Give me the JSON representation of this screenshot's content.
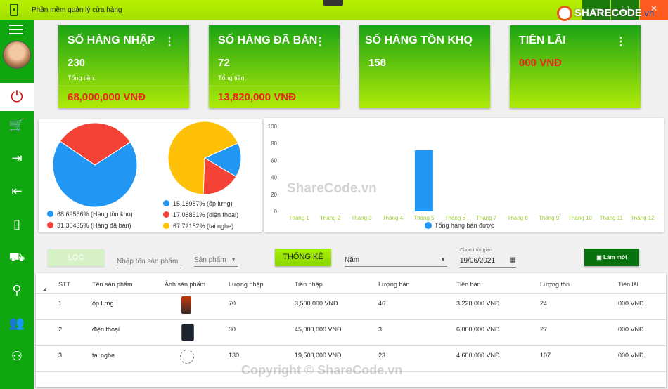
{
  "window": {
    "title": "Phần mềm quản lý cửa hàng",
    "logo_text": "SHARECODE",
    "logo_suffix": ".vn",
    "min_glyph": "—",
    "max_glyph": "▢",
    "close_glyph": "✕"
  },
  "sidebar": {
    "power_glyph": "⏻",
    "items": [
      {
        "name": "cart",
        "glyph": "🛒"
      },
      {
        "name": "export",
        "glyph": "⇥"
      },
      {
        "name": "import",
        "glyph": "⇤"
      },
      {
        "name": "phone",
        "glyph": "▯"
      },
      {
        "name": "truck",
        "glyph": "⛟"
      },
      {
        "name": "search",
        "glyph": "⚲"
      },
      {
        "name": "staff",
        "glyph": "👥"
      },
      {
        "name": "group",
        "glyph": "⚇"
      }
    ]
  },
  "cards": [
    {
      "title": "SỐ HÀNG NHẬP",
      "value": "230",
      "label": "Tổng tiền:",
      "money": "68,000,000 VNĐ",
      "menu": "⋮"
    },
    {
      "title": "SỐ HÀNG ĐÃ BÁN",
      "value": "72",
      "label": "Tổng tiền:",
      "money": "13,820,000 VNĐ",
      "menu": "⋮"
    },
    {
      "title": "SỐ HÀNG TỒN KHO",
      "value": "158",
      "label": "",
      "money": "",
      "menu": "⋮"
    },
    {
      "title": "TIỀN LÃI",
      "value": "",
      "label": "",
      "money": "000 VNĐ",
      "menu": "⋮"
    }
  ],
  "chart_data": [
    {
      "type": "pie",
      "labels": [
        "68.69566% (Hàng tồn kho)",
        "31.30435% (Hàng đã bán)"
      ],
      "values": [
        68.69566,
        31.30435
      ],
      "colors": [
        "#2196f3",
        "#f44336"
      ]
    },
    {
      "type": "pie",
      "labels": [
        "15.18987% (ốp lưng)",
        "17.08861% (điện thoại)",
        "67.72152% (tai nghe)"
      ],
      "values": [
        15.18987,
        17.08861,
        67.72152
      ],
      "colors": [
        "#2196f3",
        "#f44336",
        "#ffc107"
      ]
    },
    {
      "type": "bar",
      "categories": [
        "Tháng 1",
        "Tháng 2",
        "Tháng 3",
        "Tháng 4",
        "Tháng 5",
        "Tháng 6",
        "Tháng 7",
        "Tháng 8",
        "Tháng 9",
        "Tháng 10",
        "Tháng 11",
        "Tháng 12"
      ],
      "series": [
        {
          "name": "Tổng hàng bán được",
          "values": [
            0,
            0,
            0,
            0,
            72,
            0,
            0,
            0,
            0,
            0,
            0,
            0
          ]
        }
      ],
      "ylim": [
        0,
        100
      ],
      "yticks": [
        "0",
        "20",
        "40",
        "60",
        "80",
        "100"
      ],
      "bar_color": "#2196f3",
      "tick_color": "#9acd32"
    }
  ],
  "filter": {
    "filter_button": "LỌC",
    "product_name_placeholder": "Nhập tên sản phẩm",
    "product_select": "Sản phẩm",
    "stat_button": "THỐNG KÊ",
    "period_select": "Năm",
    "date_label": "Chọn thời gian",
    "date_value": "19/06/2021",
    "new_button": "Làm mới"
  },
  "table": {
    "columns": [
      "STT",
      "Tên sản phẩm",
      "Ảnh sản phẩm",
      "Lượng nhập",
      "Tiền nhập",
      "Lượng bán",
      "Tiền bán",
      "Lượng tồn",
      "Tiền lãi"
    ],
    "rows": [
      {
        "stt": "1",
        "name": "ốp lưng",
        "in_qty": "70",
        "in_money": "3,500,000 VNĐ",
        "sold_qty": "46",
        "sold_money": "3,220,000 VNĐ",
        "stock": "24",
        "profit": "000 VNĐ"
      },
      {
        "stt": "2",
        "name": "điện thoại",
        "in_qty": "30",
        "in_money": "45,000,000 VNĐ",
        "sold_qty": "3",
        "sold_money": "6,000,000 VNĐ",
        "stock": "27",
        "profit": "000 VNĐ"
      },
      {
        "stt": "3",
        "name": "tai nghe",
        "in_qty": "130",
        "in_money": "19,500,000 VNĐ",
        "sold_qty": "23",
        "sold_money": "4,600,000 VNĐ",
        "stock": "107",
        "profit": "000 VNĐ"
      }
    ]
  },
  "watermarks": {
    "center": "ShareCode.vn",
    "bottom": "Copyright © ShareCode.vn"
  }
}
